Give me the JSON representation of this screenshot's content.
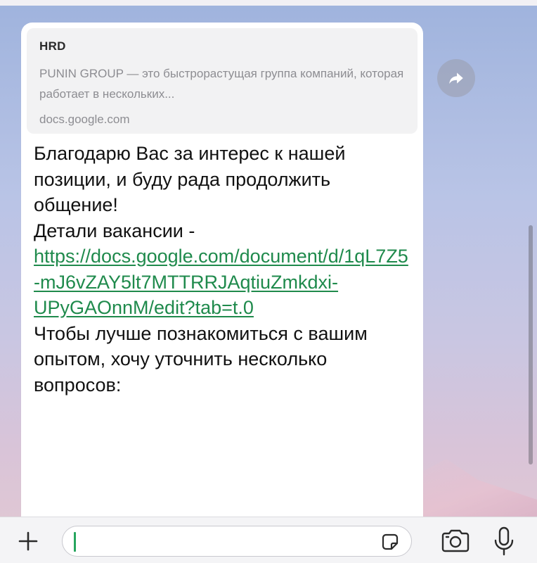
{
  "link_preview": {
    "title": "HRD",
    "description": "PUNIN GROUP — это быстрорастущая группа компаний, которая работает в нескольких...",
    "domain": "docs.google.com"
  },
  "message": {
    "intro": "Благодарю Вас за интерес к нашей позиции, и буду рада продолжить общение!",
    "details_prefix": "Детали вакансии - ",
    "link_display": "https://docs.google.com/document/d/1qL7Z5-mJ6vZAY5lt7MTTRRJAqtiuZmkdxi-UPyGAOnnM/edit?tab=t.0",
    "outro": "Чтобы лучше познакомиться с вашим опытом, хочу уточнить несколько вопросов:"
  },
  "icons": {
    "forward": "forward-icon",
    "attach": "plus-icon",
    "sticker": "sticker-icon",
    "camera": "camera-icon",
    "microphone": "microphone-icon"
  },
  "colors": {
    "link": "#1f8a4c",
    "caret": "#26a55e",
    "bubble": "#ffffff",
    "preview_bg": "#f2f2f3"
  },
  "composer": {
    "value": ""
  }
}
